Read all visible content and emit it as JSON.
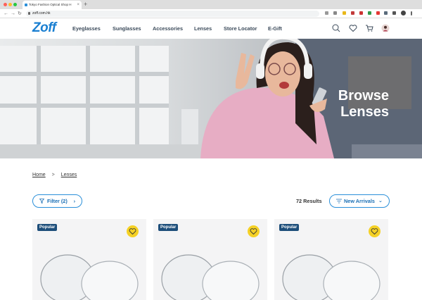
{
  "browser": {
    "tab_title": "Tokyo Fashion Optical Shop H",
    "url": "zoff.com.hk",
    "new_tab_label": "+",
    "tab_close_label": "×"
  },
  "header": {
    "logo": "Zoff",
    "nav": [
      "Eyeglasses",
      "Sunglasses",
      "Accessories",
      "Lenses",
      "Store Locator",
      "E-Gift"
    ]
  },
  "hero": {
    "title_line1": "Browse",
    "title_line2": "Lenses"
  },
  "breadcrumb": {
    "home": "Home",
    "current": "Lenses"
  },
  "toolbar": {
    "filter_label": "Filter (2)",
    "results": "72 Results",
    "sort_label": "New Arrivals"
  },
  "products": [
    {
      "badge": "Popular"
    },
    {
      "badge": "Popular"
    },
    {
      "badge": "Popular"
    }
  ],
  "colors": {
    "brand": "#1a7fd1",
    "badge": "#1d4e7a",
    "favorite": "#f5d125"
  }
}
